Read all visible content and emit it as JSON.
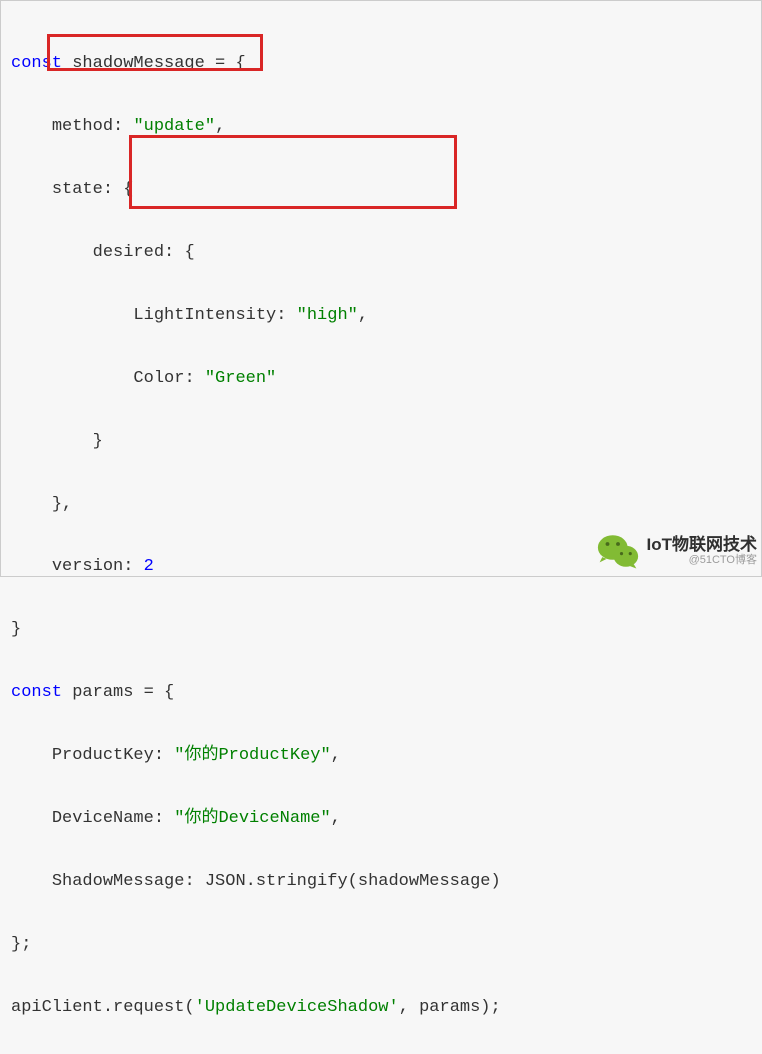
{
  "code": {
    "line1": {
      "kw": "const",
      "ident": " shadowMessage ",
      "eq": "= ",
      "brace": "{"
    },
    "line2": {
      "indent": "    ",
      "prop": "method",
      "colon": ": ",
      "str": "\"update\"",
      "comma": ","
    },
    "line3": {
      "indent": "    ",
      "prop": "state",
      "colon": ": ",
      "brace": "{"
    },
    "line4": {
      "indent": "        ",
      "prop": "desired",
      "colon": ": ",
      "brace": "{"
    },
    "line5": {
      "indent": "            ",
      "prop": "LightIntensity",
      "colon": ": ",
      "str": "\"high\"",
      "comma": ","
    },
    "line6": {
      "indent": "            ",
      "prop": "Color",
      "colon": ": ",
      "str": "\"Green\""
    },
    "line7": {
      "indent": "        ",
      "brace": "}"
    },
    "line8": {
      "indent": "    ",
      "brace": "}",
      "comma": ","
    },
    "line9": {
      "indent": "    ",
      "prop": "version",
      "colon": ": ",
      "num": "2"
    },
    "line10": {
      "brace": "}"
    },
    "line11": {
      "kw": "const",
      "ident": " params ",
      "eq": "= ",
      "brace": "{"
    },
    "line12": {
      "indent": "    ",
      "prop": "ProductKey",
      "colon": ": ",
      "str": "\"你的ProductKey\"",
      "comma": ","
    },
    "line13": {
      "indent": "    ",
      "prop": "DeviceName",
      "colon": ": ",
      "str": "\"你的DeviceName\"",
      "comma": ","
    },
    "line14": {
      "indent": "    ",
      "prop": "ShadowMessage",
      "colon": ": ",
      "call": "JSON.stringify(shadowMessage)"
    },
    "line15": {
      "brace": "}",
      "semi": ";"
    },
    "line16": {
      "call1": "apiClient.request(",
      "str": "'UpdateDeviceShadow'",
      "call2": ", params);"
    }
  },
  "watermark": {
    "main": "IoT物联网技术",
    "sub": "@51CTO博客"
  }
}
